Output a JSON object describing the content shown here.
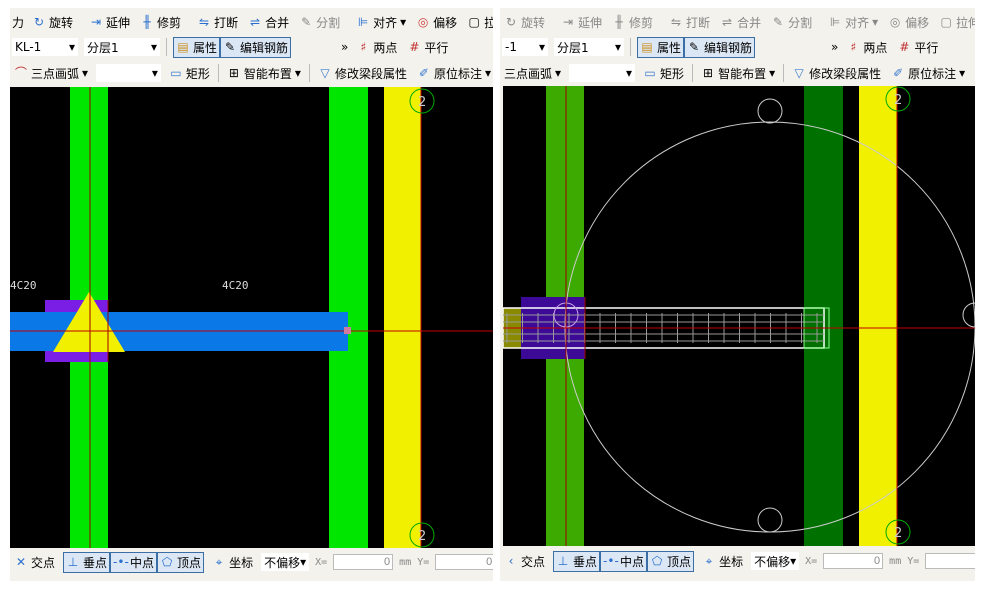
{
  "left": {
    "toolbar1": [
      "力",
      "旋转",
      "延伸",
      "修剪",
      "打断",
      "合并",
      "分割",
      "对齐",
      "偏移",
      "拉伸"
    ],
    "toolbar2": {
      "element": "KL-1",
      "layer": "分层1",
      "props": "属性",
      "edit_rebar": "编辑钢筋",
      "more": "»",
      "two_point": "两点",
      "parallel": "平行"
    },
    "toolbar3": {
      "arc": "三点画弧",
      "rect": "矩形",
      "smart": "智能布置",
      "modify": "修改梁段属性",
      "inplace": "原位标注"
    },
    "labels": [
      "4C20",
      "4C20"
    ],
    "axis": "2"
  },
  "right": {
    "toolbar1": [
      "旋转",
      "延伸",
      "修剪",
      "打断",
      "合并",
      "分割",
      "对齐",
      "偏移",
      "拉伸"
    ],
    "toolbar2": {
      "element": "-1",
      "layer": "分层1",
      "props": "属性",
      "edit_rebar": "编辑钢筋",
      "more": "»",
      "two_point": "两点",
      "parallel": "平行"
    },
    "toolbar3": {
      "arc": "三点画弧",
      "rect": "矩形",
      "smart": "智能布置",
      "modify": "修改梁段属性",
      "inplace": "原位标注"
    },
    "axis": "2"
  },
  "status": {
    "intersect": "交点",
    "perp": "垂点",
    "mid": "中点",
    "vertex": "顶点",
    "coord": "坐标",
    "offset": "不偏移",
    "x_label": "X=",
    "x_value": "0",
    "unit": "mm",
    "y_label": "Y=",
    "y_value": "0"
  },
  "colors": {
    "column_green": "#00e600",
    "beam_blue": "#0a78e6",
    "yellow": "#f0f000",
    "purple": "#7a1ee6",
    "axis_line": "#c00000"
  }
}
